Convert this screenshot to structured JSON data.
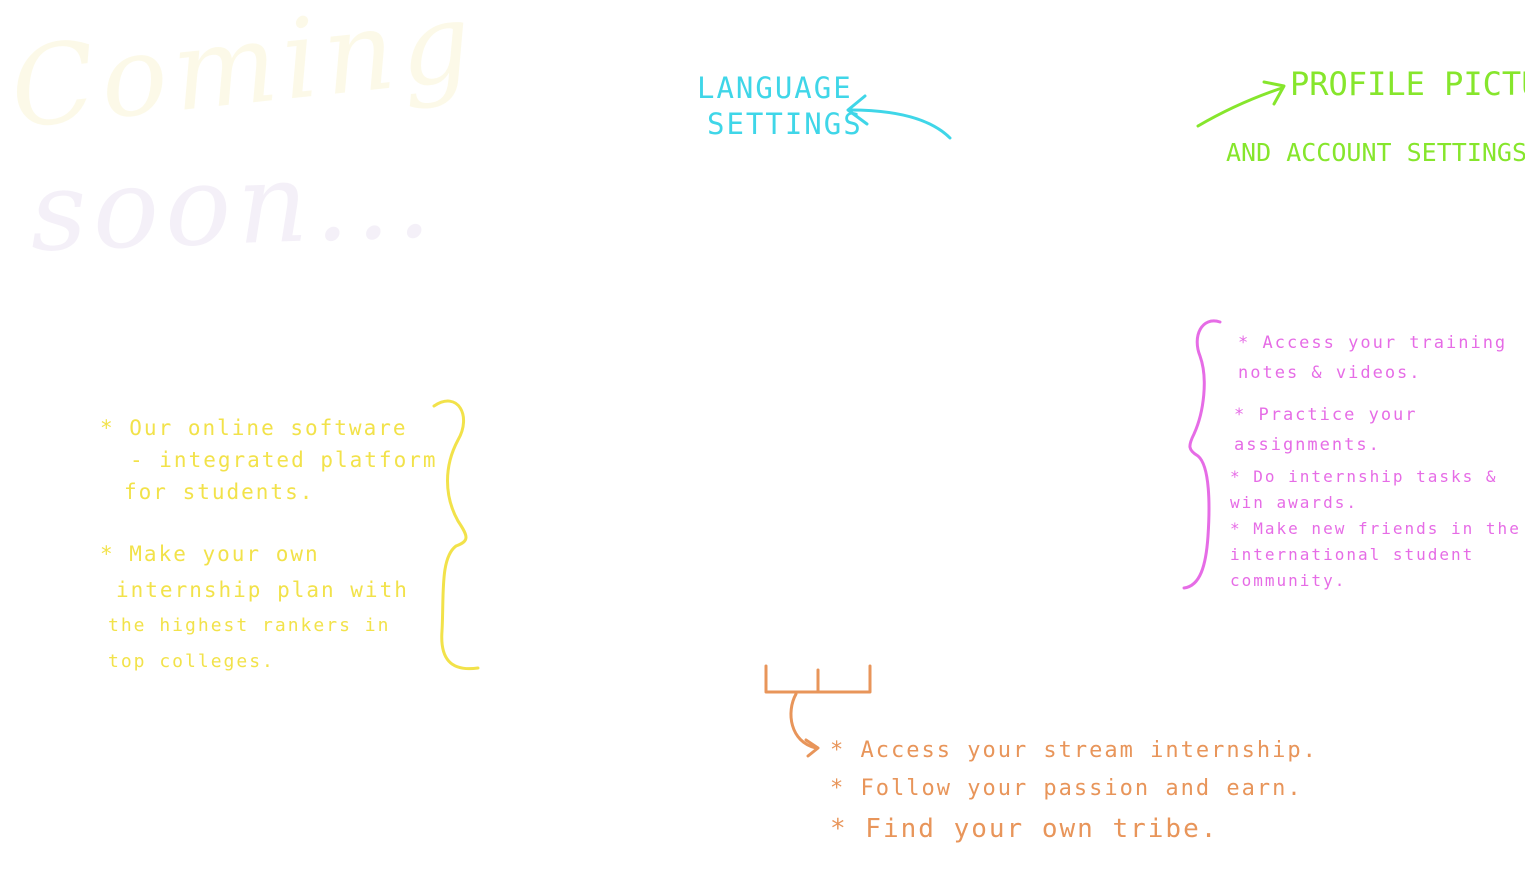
{
  "watermark": {
    "line1": "Coming",
    "line2": "soon..."
  },
  "language": {
    "line1": "Language",
    "line2": "Settings"
  },
  "profile": {
    "line1": "Profile Picture",
    "line2": "and account settings"
  },
  "left_notes": {
    "items": [
      {
        "lines": [
          "* Our online software",
          "- integrated platform",
          "for students."
        ]
      },
      {
        "lines": [
          "* Make your own",
          "internship plan with",
          "the highest rankers in",
          "top colleges."
        ]
      }
    ]
  },
  "right_notes": {
    "items": [
      {
        "lines": [
          "* Access your training",
          "notes & videos."
        ]
      },
      {
        "lines": [
          "* Practice your",
          "assignments."
        ]
      },
      {
        "lines": [
          "* Do internship tasks &",
          "win awards."
        ]
      },
      {
        "lines": [
          "* Make new friends in the",
          "international student",
          "community."
        ]
      }
    ]
  },
  "bottom_notes": {
    "items": [
      "* Access your stream internship.",
      "* Follow your passion and earn.",
      "* Find your own tribe."
    ]
  },
  "colors": {
    "yellow": "#f2e24a",
    "cyan": "#3fd6e8",
    "green": "#86e62c",
    "pink": "#e66ce6",
    "orange": "#e8955a"
  }
}
